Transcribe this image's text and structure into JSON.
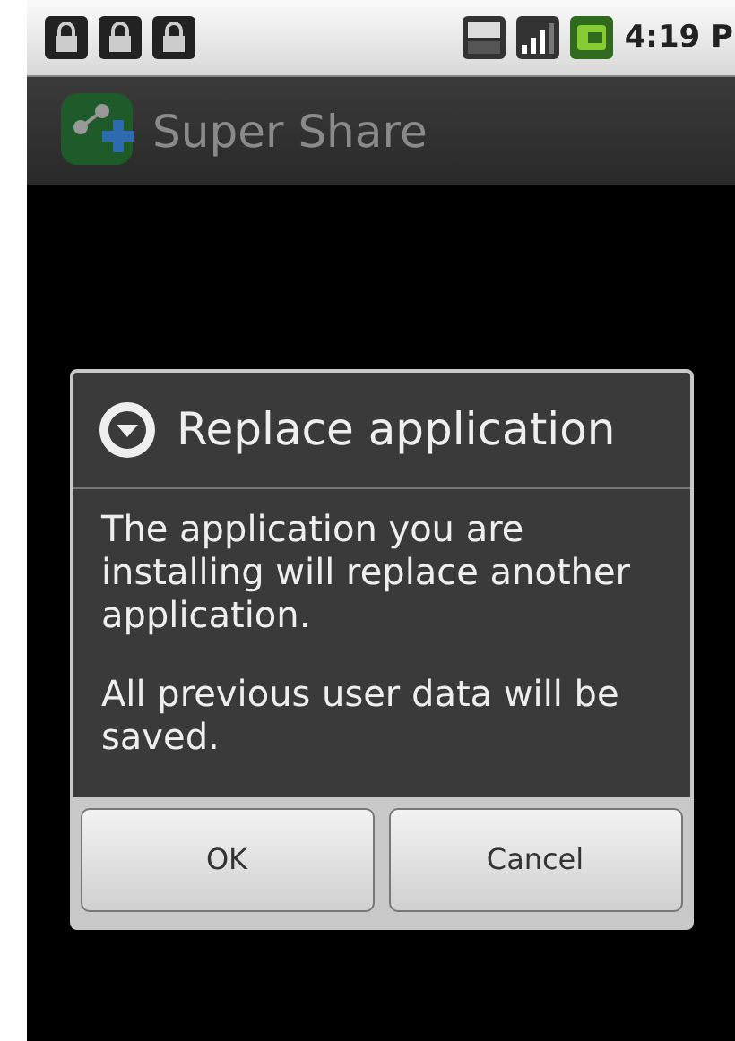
{
  "status_bar": {
    "time": "4:19 P"
  },
  "app_bar": {
    "title": "Super Share"
  },
  "dialog": {
    "title": "Replace application",
    "paragraphs": [
      "The application you are installing will replace another application.",
      "All previous user data will be saved."
    ],
    "buttons": [
      "OK",
      "Cancel"
    ]
  }
}
